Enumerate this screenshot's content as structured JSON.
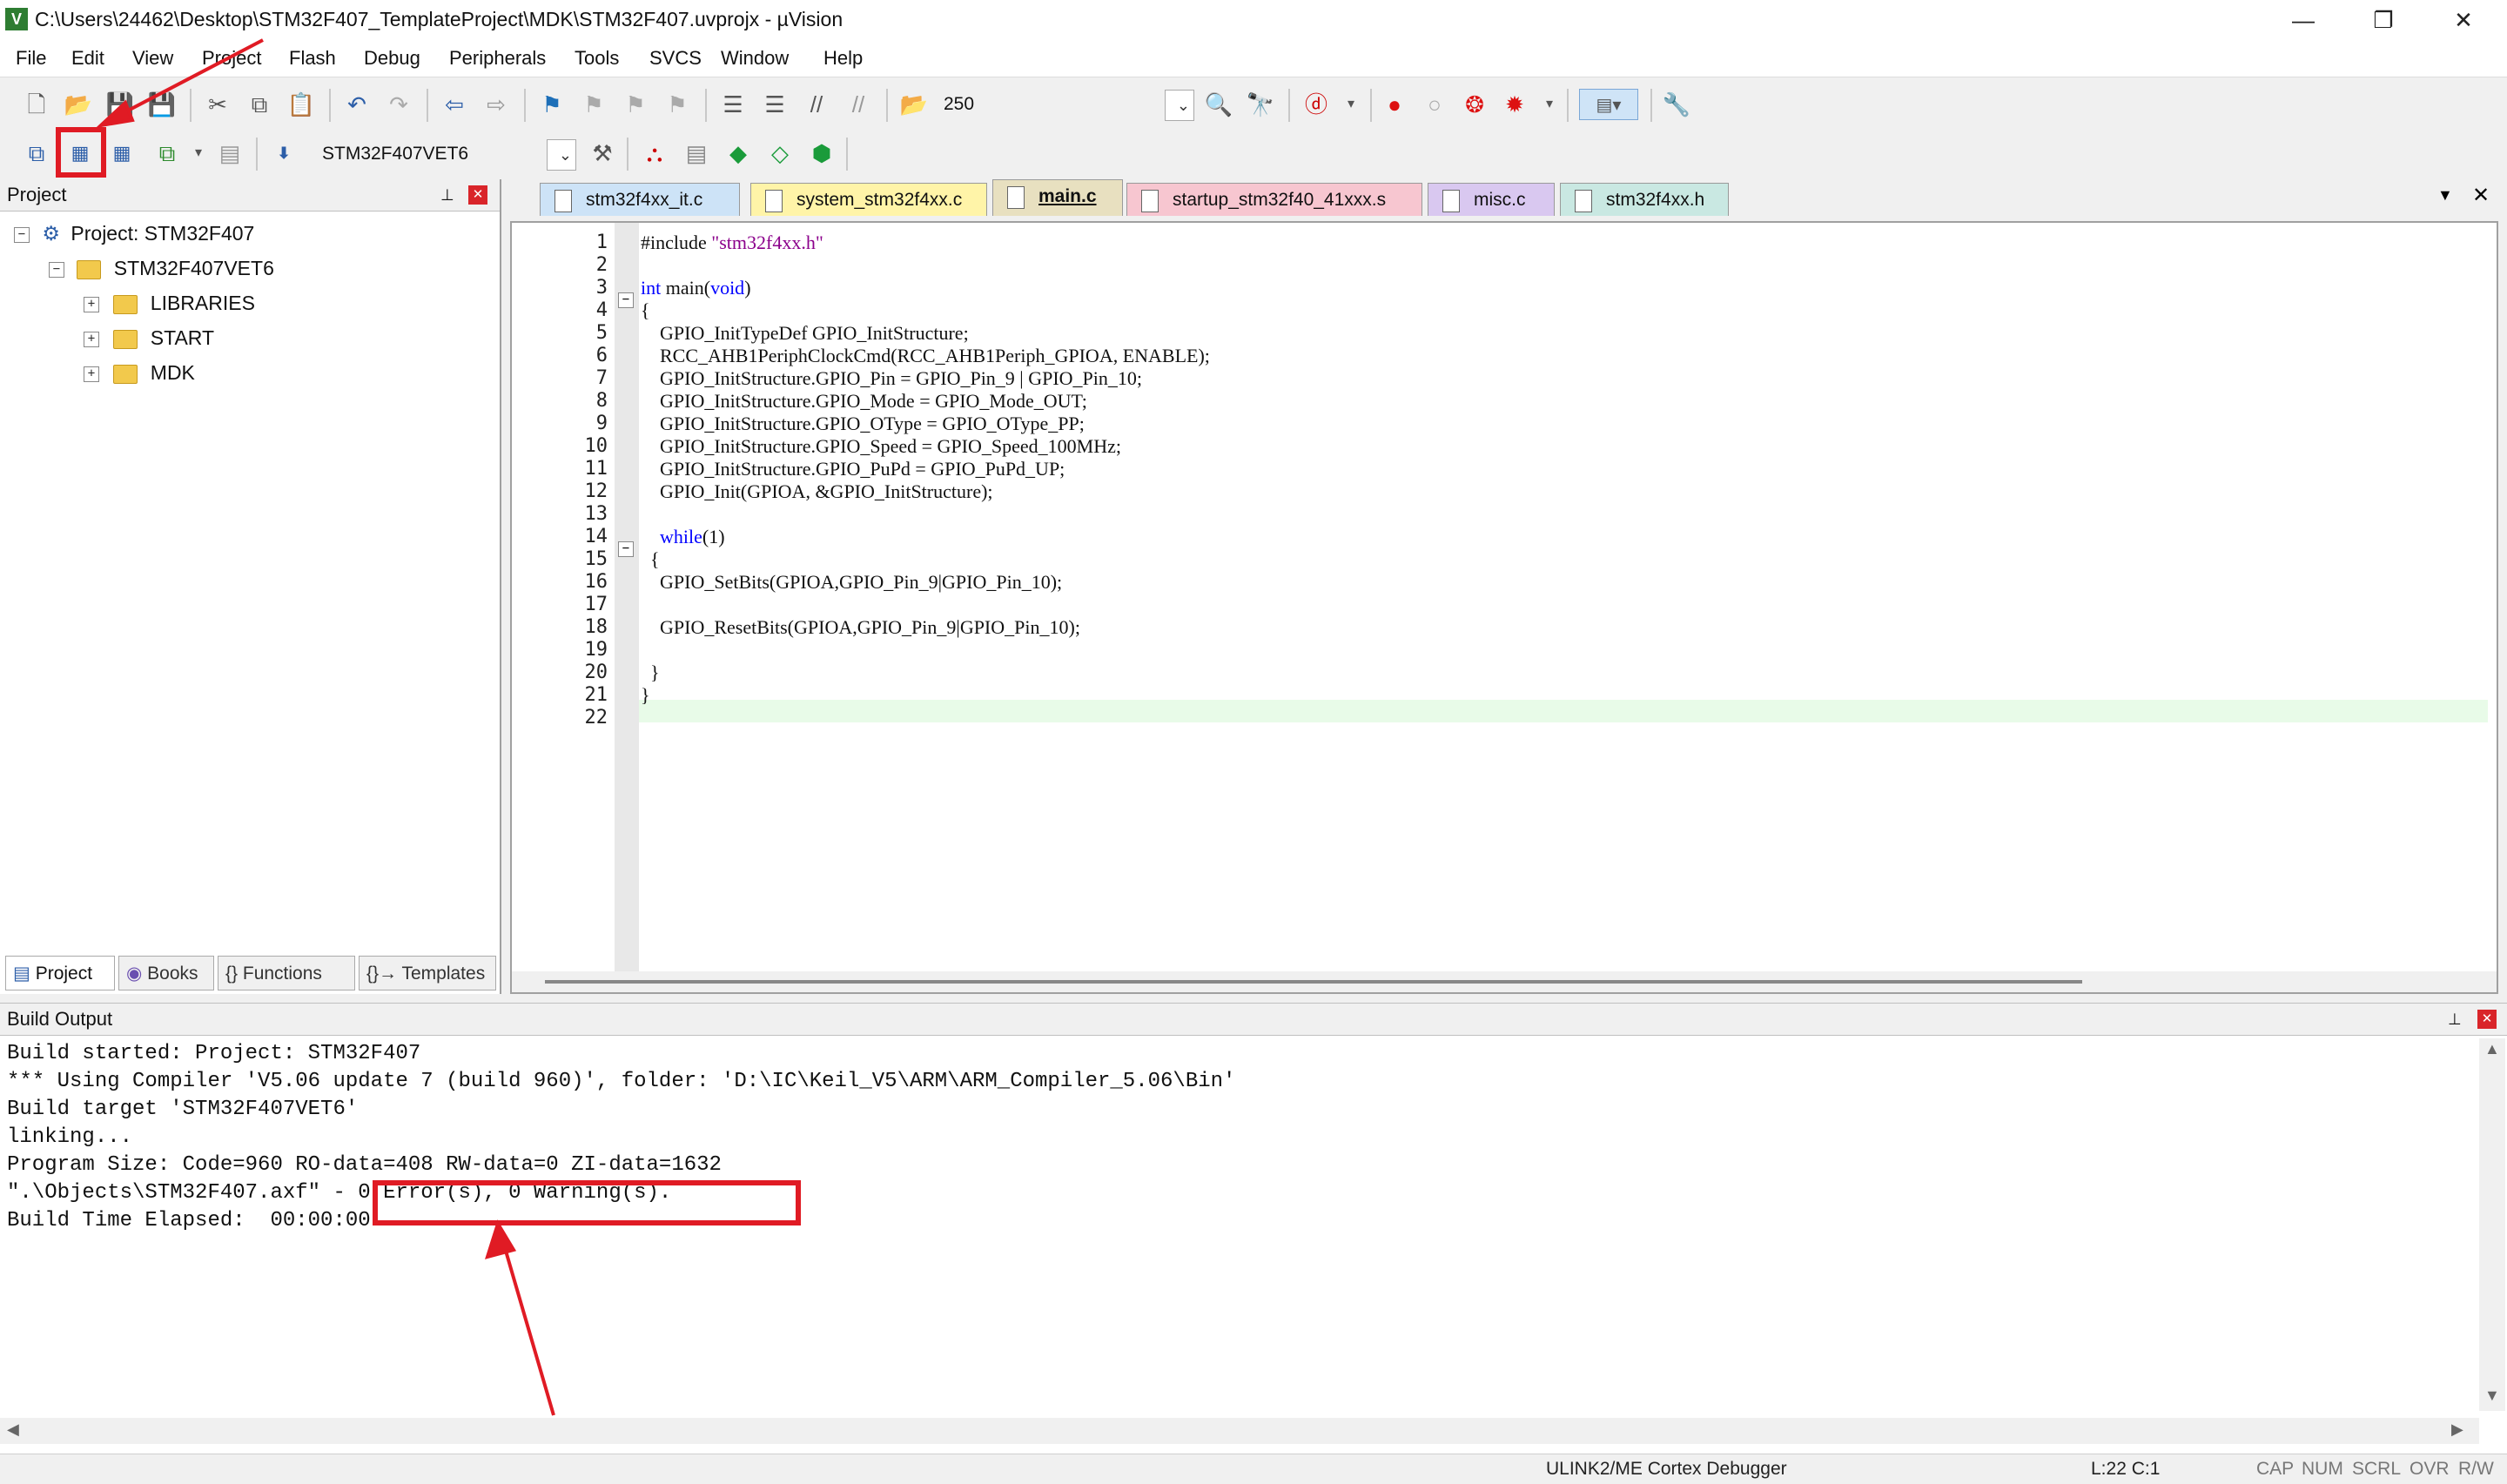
{
  "window": {
    "app_icon": "V",
    "title": "C:\\Users\\24462\\Desktop\\STM32F407_TemplateProject\\MDK\\STM32F407.uvprojx - µVision",
    "minimize": "—",
    "restore": "❐",
    "close": "✕"
  },
  "menu": [
    "File",
    "Edit",
    "View",
    "Project",
    "Flash",
    "Debug",
    "Peripherals",
    "Tools",
    "SVCS",
    "Window",
    "Help"
  ],
  "toolbar1": {
    "zoom_value": "250"
  },
  "toolbar2": {
    "target": "STM32F407VET6"
  },
  "project_panel": {
    "title": "Project",
    "pin": "⊥",
    "close": "✕",
    "tree": {
      "root": "Project: STM32F407",
      "target": "STM32F407VET6",
      "groups": [
        "LIBRARIES",
        "START",
        "MDK"
      ]
    },
    "tabs": [
      "Project",
      "Books",
      "{} Functions",
      "{}→ Templates"
    ]
  },
  "editor": {
    "tabs": [
      {
        "label": "stm32f4xx_it.c",
        "color": "#cde3f7"
      },
      {
        "label": "system_stm32f4xx.c",
        "color": "#fff4a8"
      },
      {
        "label": "main.c",
        "color": "#e8e0c0"
      },
      {
        "label": "startup_stm32f40_41xxx.s",
        "color": "#f7c6d0"
      },
      {
        "label": "misc.c",
        "color": "#d9c8f0"
      },
      {
        "label": "stm32f4xx.h",
        "color": "#c9e8e2"
      }
    ],
    "line_numbers": [
      "1",
      "2",
      "3",
      "4",
      "5",
      "6",
      "7",
      "8",
      "9",
      "10",
      "11",
      "12",
      "13",
      "14",
      "15",
      "16",
      "17",
      "18",
      "19",
      "20",
      "21",
      "22"
    ],
    "code": [
      "#include \"stm32f4xx.h\"",
      "",
      "int main(void)",
      "{",
      "    GPIO_InitTypeDef GPIO_InitStructure;",
      "    RCC_AHB1PeriphClockCmd(RCC_AHB1Periph_GPIOA, ENABLE);",
      "    GPIO_InitStructure.GPIO_Pin = GPIO_Pin_9 | GPIO_Pin_10;",
      "    GPIO_InitStructure.GPIO_Mode = GPIO_Mode_OUT;",
      "    GPIO_InitStructure.GPIO_OType = GPIO_OType_PP;",
      "    GPIO_InitStructure.GPIO_Speed = GPIO_Speed_100MHz;",
      "    GPIO_InitStructure.GPIO_PuPd = GPIO_PuPd_UP;",
      "    GPIO_Init(GPIOA, &GPIO_InitStructure);",
      "",
      "    while(1)",
      "  {",
      "    GPIO_SetBits(GPIOA,GPIO_Pin_9|GPIO_Pin_10);",
      "",
      "    GPIO_ResetBits(GPIOA,GPIO_Pin_9|GPIO_Pin_10);",
      "",
      "  }",
      "}",
      ""
    ]
  },
  "build_output": {
    "title": "Build Output",
    "lines": [
      "Build started: Project: STM32F407",
      "*** Using Compiler 'V5.06 update 7 (build 960)', folder: 'D:\\IC\\Keil_V5\\ARM\\ARM_Compiler_5.06\\Bin'",
      "Build target 'STM32F407VET6'",
      "linking...",
      "Program Size: Code=960 RO-data=408 RW-data=0 ZI-data=1632",
      "\".\\Objects\\STM32F407.axf\" - 0 Error(s), 0 Warning(s).",
      "Build Time Elapsed:  00:00:00"
    ]
  },
  "statusbar": {
    "debugger": "ULINK2/ME Cortex Debugger",
    "position": "L:22 C:1",
    "caps": "CAP",
    "num": "NUM",
    "scrl": "SCRL",
    "ovr": "OVR",
    "rw": "R/W"
  },
  "annotation_color": "#e01b24"
}
